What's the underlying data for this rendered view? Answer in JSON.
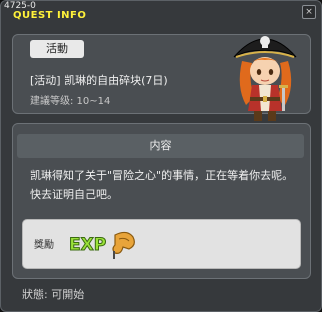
{
  "window": {
    "id_label": "4725-0",
    "title": "QUEST INFO",
    "close_label": "×"
  },
  "quest": {
    "category": "活動",
    "name": "[活动] 凯琳的自由碎块(7日)",
    "level_range": "建議等级: 10~14"
  },
  "content": {
    "header": "内容",
    "description": "凯琳得知了关于\"冒险之心\"的事情，正在等着你去呢。快去证明自己吧。"
  },
  "reward": {
    "label": "獎勵",
    "exp_text": "EXP"
  },
  "status": {
    "text": "狀態: 可開始"
  },
  "icons": [
    "close-icon",
    "npc-pirate-portrait-icon",
    "exp-icon"
  ],
  "colors": {
    "title": "#fff23a",
    "window_bg": "#36393c",
    "panel_bg": "#4a4e52",
    "reward_bg": "#e2e2e2"
  }
}
